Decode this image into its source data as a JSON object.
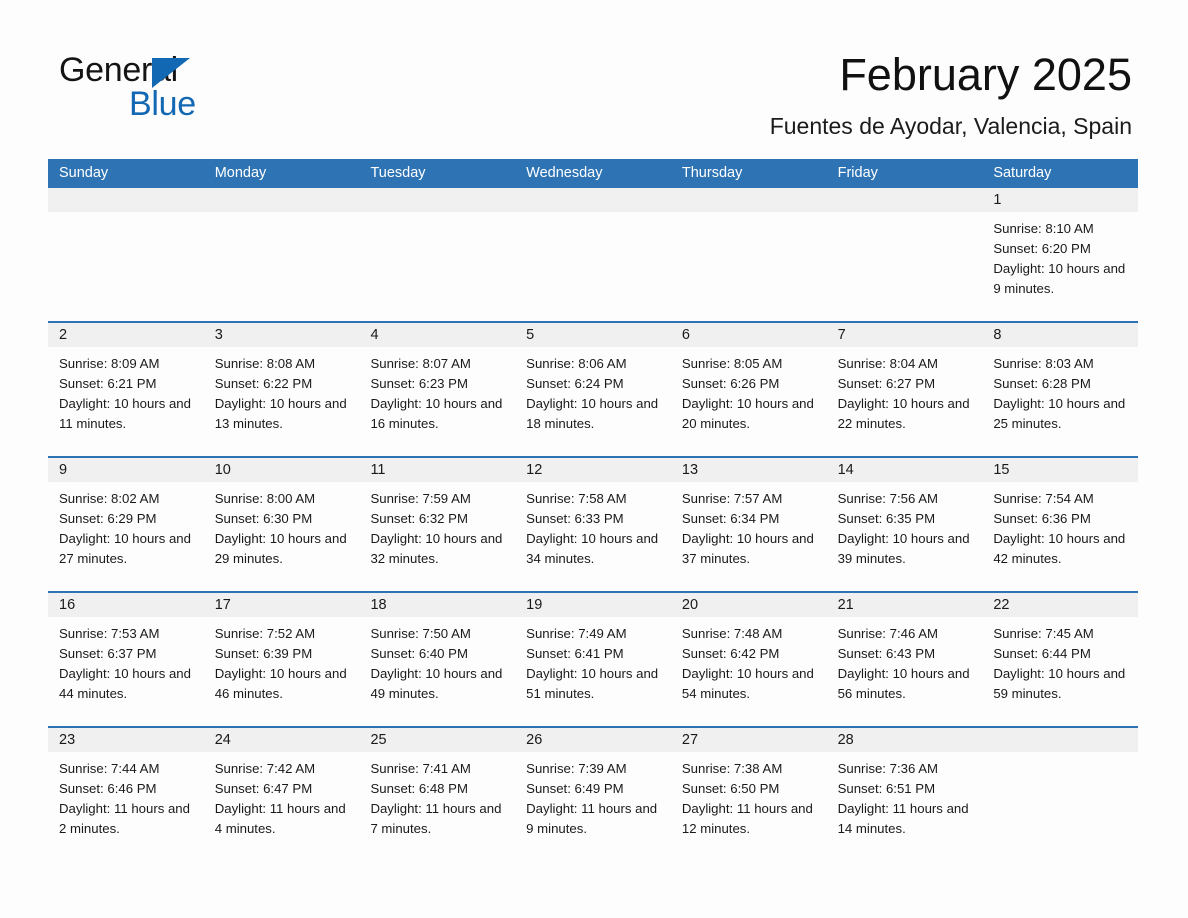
{
  "brand": {
    "name_part1": "General",
    "name_part2": "Blue",
    "triangle_color": "#1268b3"
  },
  "header": {
    "title": "February 2025",
    "subtitle": "Fuentes de Ayodar, Valencia, Spain"
  },
  "theme": {
    "header_blue": "#2e74b5",
    "day_band_gray": "#f0f0f0",
    "page_background": "#fdfdfd",
    "text_color": "#1a1a1a"
  },
  "weekdays": [
    "Sunday",
    "Monday",
    "Tuesday",
    "Wednesday",
    "Thursday",
    "Friday",
    "Saturday"
  ],
  "weeks": [
    {
      "days": [
        {
          "date": "",
          "sunrise": "",
          "sunset": "",
          "daylight": "",
          "empty": true
        },
        {
          "date": "",
          "sunrise": "",
          "sunset": "",
          "daylight": "",
          "empty": true
        },
        {
          "date": "",
          "sunrise": "",
          "sunset": "",
          "daylight": "",
          "empty": true
        },
        {
          "date": "",
          "sunrise": "",
          "sunset": "",
          "daylight": "",
          "empty": true
        },
        {
          "date": "",
          "sunrise": "",
          "sunset": "",
          "daylight": "",
          "empty": true
        },
        {
          "date": "",
          "sunrise": "",
          "sunset": "",
          "daylight": "",
          "empty": true
        },
        {
          "date": "1",
          "sunrise": "Sunrise: 8:10 AM",
          "sunset": "Sunset: 6:20 PM",
          "daylight": "Daylight: 10 hours and 9 minutes.",
          "empty": false
        }
      ]
    },
    {
      "days": [
        {
          "date": "2",
          "sunrise": "Sunrise: 8:09 AM",
          "sunset": "Sunset: 6:21 PM",
          "daylight": "Daylight: 10 hours and 11 minutes.",
          "empty": false
        },
        {
          "date": "3",
          "sunrise": "Sunrise: 8:08 AM",
          "sunset": "Sunset: 6:22 PM",
          "daylight": "Daylight: 10 hours and 13 minutes.",
          "empty": false
        },
        {
          "date": "4",
          "sunrise": "Sunrise: 8:07 AM",
          "sunset": "Sunset: 6:23 PM",
          "daylight": "Daylight: 10 hours and 16 minutes.",
          "empty": false
        },
        {
          "date": "5",
          "sunrise": "Sunrise: 8:06 AM",
          "sunset": "Sunset: 6:24 PM",
          "daylight": "Daylight: 10 hours and 18 minutes.",
          "empty": false
        },
        {
          "date": "6",
          "sunrise": "Sunrise: 8:05 AM",
          "sunset": "Sunset: 6:26 PM",
          "daylight": "Daylight: 10 hours and 20 minutes.",
          "empty": false
        },
        {
          "date": "7",
          "sunrise": "Sunrise: 8:04 AM",
          "sunset": "Sunset: 6:27 PM",
          "daylight": "Daylight: 10 hours and 22 minutes.",
          "empty": false
        },
        {
          "date": "8",
          "sunrise": "Sunrise: 8:03 AM",
          "sunset": "Sunset: 6:28 PM",
          "daylight": "Daylight: 10 hours and 25 minutes.",
          "empty": false
        }
      ]
    },
    {
      "days": [
        {
          "date": "9",
          "sunrise": "Sunrise: 8:02 AM",
          "sunset": "Sunset: 6:29 PM",
          "daylight": "Daylight: 10 hours and 27 minutes.",
          "empty": false
        },
        {
          "date": "10",
          "sunrise": "Sunrise: 8:00 AM",
          "sunset": "Sunset: 6:30 PM",
          "daylight": "Daylight: 10 hours and 29 minutes.",
          "empty": false
        },
        {
          "date": "11",
          "sunrise": "Sunrise: 7:59 AM",
          "sunset": "Sunset: 6:32 PM",
          "daylight": "Daylight: 10 hours and 32 minutes.",
          "empty": false
        },
        {
          "date": "12",
          "sunrise": "Sunrise: 7:58 AM",
          "sunset": "Sunset: 6:33 PM",
          "daylight": "Daylight: 10 hours and 34 minutes.",
          "empty": false
        },
        {
          "date": "13",
          "sunrise": "Sunrise: 7:57 AM",
          "sunset": "Sunset: 6:34 PM",
          "daylight": "Daylight: 10 hours and 37 minutes.",
          "empty": false
        },
        {
          "date": "14",
          "sunrise": "Sunrise: 7:56 AM",
          "sunset": "Sunset: 6:35 PM",
          "daylight": "Daylight: 10 hours and 39 minutes.",
          "empty": false
        },
        {
          "date": "15",
          "sunrise": "Sunrise: 7:54 AM",
          "sunset": "Sunset: 6:36 PM",
          "daylight": "Daylight: 10 hours and 42 minutes.",
          "empty": false
        }
      ]
    },
    {
      "days": [
        {
          "date": "16",
          "sunrise": "Sunrise: 7:53 AM",
          "sunset": "Sunset: 6:37 PM",
          "daylight": "Daylight: 10 hours and 44 minutes.",
          "empty": false
        },
        {
          "date": "17",
          "sunrise": "Sunrise: 7:52 AM",
          "sunset": "Sunset: 6:39 PM",
          "daylight": "Daylight: 10 hours and 46 minutes.",
          "empty": false
        },
        {
          "date": "18",
          "sunrise": "Sunrise: 7:50 AM",
          "sunset": "Sunset: 6:40 PM",
          "daylight": "Daylight: 10 hours and 49 minutes.",
          "empty": false
        },
        {
          "date": "19",
          "sunrise": "Sunrise: 7:49 AM",
          "sunset": "Sunset: 6:41 PM",
          "daylight": "Daylight: 10 hours and 51 minutes.",
          "empty": false
        },
        {
          "date": "20",
          "sunrise": "Sunrise: 7:48 AM",
          "sunset": "Sunset: 6:42 PM",
          "daylight": "Daylight: 10 hours and 54 minutes.",
          "empty": false
        },
        {
          "date": "21",
          "sunrise": "Sunrise: 7:46 AM",
          "sunset": "Sunset: 6:43 PM",
          "daylight": "Daylight: 10 hours and 56 minutes.",
          "empty": false
        },
        {
          "date": "22",
          "sunrise": "Sunrise: 7:45 AM",
          "sunset": "Sunset: 6:44 PM",
          "daylight": "Daylight: 10 hours and 59 minutes.",
          "empty": false
        }
      ]
    },
    {
      "days": [
        {
          "date": "23",
          "sunrise": "Sunrise: 7:44 AM",
          "sunset": "Sunset: 6:46 PM",
          "daylight": "Daylight: 11 hours and 2 minutes.",
          "empty": false
        },
        {
          "date": "24",
          "sunrise": "Sunrise: 7:42 AM",
          "sunset": "Sunset: 6:47 PM",
          "daylight": "Daylight: 11 hours and 4 minutes.",
          "empty": false
        },
        {
          "date": "25",
          "sunrise": "Sunrise: 7:41 AM",
          "sunset": "Sunset: 6:48 PM",
          "daylight": "Daylight: 11 hours and 7 minutes.",
          "empty": false
        },
        {
          "date": "26",
          "sunrise": "Sunrise: 7:39 AM",
          "sunset": "Sunset: 6:49 PM",
          "daylight": "Daylight: 11 hours and 9 minutes.",
          "empty": false
        },
        {
          "date": "27",
          "sunrise": "Sunrise: 7:38 AM",
          "sunset": "Sunset: 6:50 PM",
          "daylight": "Daylight: 11 hours and 12 minutes.",
          "empty": false
        },
        {
          "date": "28",
          "sunrise": "Sunrise: 7:36 AM",
          "sunset": "Sunset: 6:51 PM",
          "daylight": "Daylight: 11 hours and 14 minutes.",
          "empty": false
        },
        {
          "date": "",
          "sunrise": "",
          "sunset": "",
          "daylight": "",
          "empty": true
        }
      ]
    }
  ]
}
